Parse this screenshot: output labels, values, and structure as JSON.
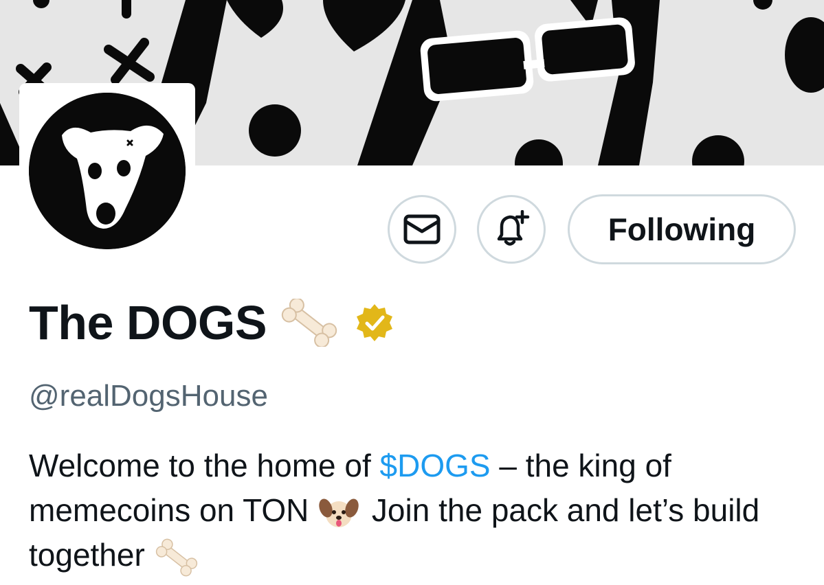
{
  "header": {
    "banner": "banner-image",
    "avatar": "dog-logo-avatar"
  },
  "actions": {
    "message_icon": "mail-icon",
    "notify_icon": "bell-plus-icon",
    "following_label": "Following"
  },
  "profile": {
    "display_name": "The DOGS",
    "name_emoji": "bone-emoji",
    "verified_badge": "gold-verified-badge",
    "handle": "@realDogsHouse"
  },
  "bio": {
    "part1": "Welcome to the home of ",
    "cashtag": "$DOGS",
    "part2": " – the king of memecoins on TON ",
    "part3": " Join the pack and let’s build together ",
    "emoji_dog": "dog-face-emoji",
    "emoji_bone": "bone-emoji"
  },
  "colors": {
    "link": "#1d9bf0",
    "secondary_text": "#536471",
    "border": "#cfd9de",
    "verified_gold": "#e2b719"
  }
}
